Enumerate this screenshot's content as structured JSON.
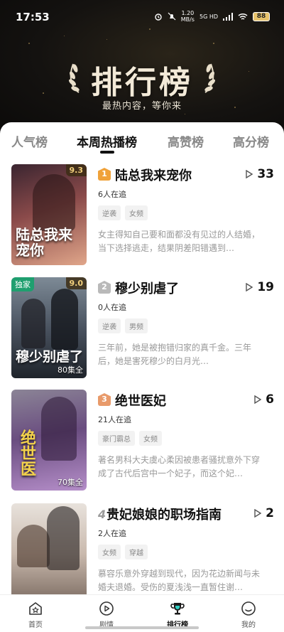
{
  "status_bar": {
    "time": "17:53",
    "net_speed": "1.20",
    "net_unit": "MB/s",
    "signal": "5G HD",
    "battery": "88"
  },
  "banner": {
    "title": "排行榜",
    "subtitle": "最热内容，等你来"
  },
  "tabs": [
    {
      "label": "人气榜",
      "active": false
    },
    {
      "label": "本周热播榜",
      "active": true
    },
    {
      "label": "高赞榜",
      "active": false
    },
    {
      "label": "高分榜",
      "active": false
    }
  ],
  "items": [
    {
      "rank": "1",
      "title": "陆总我来宠你",
      "plays": "33",
      "followers": "6人在追",
      "tags": [
        "逆袭",
        "女频"
      ],
      "description": "女主得知自己要和面都没有见过的人结婚，当下选择逃走，结果阴差阳错遇到…",
      "score": "9.3",
      "poster_text": "陆总我来宠你",
      "colors": {
        "top": "#6e3a3a",
        "bottom": "#c98d7a",
        "rank_badge": "#f0a23a"
      }
    },
    {
      "rank": "2",
      "title": "穆少别虐了",
      "plays": "19",
      "followers": "0人在追",
      "tags": [
        "逆袭",
        "男频"
      ],
      "description": "三年前，她是被抱错归家的真千金。三年后，她是害死穆少的白月光…",
      "score": "9.0",
      "exclusive": "独家",
      "episodes": "80集全",
      "poster_text": "穆少别虐了",
      "colors": {
        "top": "#5a6b7a",
        "bottom": "#2b3038",
        "rank_badge": "#b9b9b9"
      }
    },
    {
      "rank": "3",
      "title": "绝世医妃",
      "plays": "6",
      "followers": "21人在追",
      "tags": [
        "豪门霸总",
        "女频"
      ],
      "description": "著名男科大夫虞心柔因被患者骚扰意外下穿成了古代后宫中一个妃子，而这个妃…",
      "episodes": "70集全",
      "poster_text": "绝世医",
      "colors": {
        "top": "#7a6a8a",
        "bottom": "#5a3a7a",
        "rank_badge": "#e89a6a"
      }
    },
    {
      "rank": "4",
      "title": "贵妃娘娘的职场指南",
      "plays": "2",
      "followers": "2人在追",
      "tags": [
        "女频",
        "穿越"
      ],
      "description": "慕容乐意外穿越到现代，因为花边新闻与未婚夫退婚。受伤的夏浅浅一直暂住谢…",
      "colors": {
        "top": "#d9cfc7",
        "bottom": "#8a7a70"
      }
    }
  ],
  "bottom_nav": [
    {
      "label": "首页",
      "icon": "home-star-icon",
      "active": false
    },
    {
      "label": "剧情",
      "icon": "play-circle-icon",
      "active": false
    },
    {
      "label": "排行榜",
      "icon": "trophy-icon",
      "active": true
    },
    {
      "label": "我的",
      "icon": "profile-smile-icon",
      "active": false
    }
  ]
}
